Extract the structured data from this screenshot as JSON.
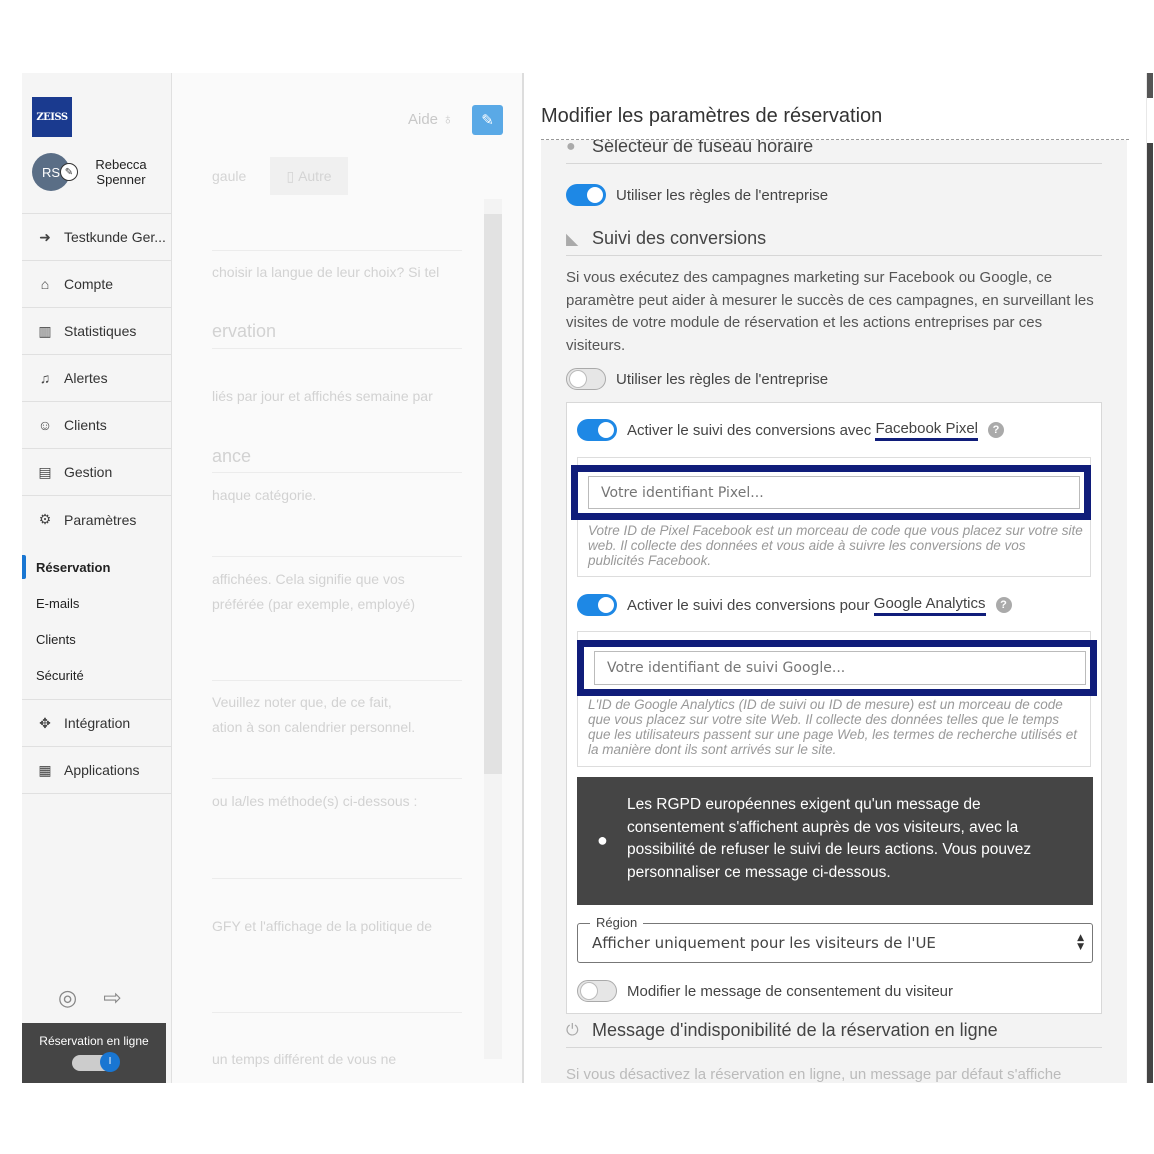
{
  "sidebar": {
    "logo_text": "ZEISS",
    "avatar_initials": "RS",
    "user_name": "Rebecca Spenner",
    "nav": [
      {
        "label": "Testkunde Ger...",
        "icon": "back-circle-icon"
      },
      {
        "label": "Compte",
        "icon": "briefcase-icon"
      },
      {
        "label": "Statistiques",
        "icon": "bar-chart-icon"
      },
      {
        "label": "Alertes",
        "icon": "bell-icon"
      },
      {
        "label": "Clients",
        "icon": "user-icon"
      },
      {
        "label": "Gestion",
        "icon": "toolbox-icon"
      },
      {
        "label": "Paramètres",
        "icon": "gears-icon"
      }
    ],
    "sub_nav": [
      {
        "label": "Réservation",
        "active": true
      },
      {
        "label": "E-mails"
      },
      {
        "label": "Clients"
      },
      {
        "label": "Sécurité"
      }
    ],
    "nav_bottom": [
      {
        "label": "Intégration",
        "icon": "puzzle-icon"
      },
      {
        "label": "Applications",
        "icon": "grid-icon"
      }
    ],
    "online_booking_label": "Réservation en ligne",
    "online_toggle_text": "I"
  },
  "background_page": {
    "help_label": "Aide",
    "tabs": [
      "gaule",
      "Autre"
    ],
    "lines": [
      "choisir la langue de leur choix? Si tel",
      "ervation",
      "liés par jour et affichés semaine par",
      "ance",
      "haque catégorie.",
      "affichées. Cela signifie que vos",
      "préférée (par exemple, employé)",
      "Veuillez noter que, de ce fait,",
      "ation à son calendrier personnel.",
      "ou la/les méthode(s) ci-dessous :",
      "GFY et l'affichage de la politique de",
      "un temps différent de vous ne"
    ]
  },
  "panel": {
    "title": "Modifier les paramètres de réservation",
    "timezone_heading": "Sélecteur de fuseau horaire",
    "timezone_toggle_label": "Utiliser les règles de l'entreprise",
    "conversions_heading": "Suivi des conversions",
    "conversions_description": "Si vous exécutez des campagnes marketing sur Facebook ou Google, ce paramètre peut aider à mesurer le succès de ces campagnes, en surveillant les visites de votre module de réservation et les actions entreprises par ces visiteurs.",
    "conversions_toggle_label": "Utiliser les règles de l'entreprise",
    "facebook_toggle_prefix": "Activer le suivi des conversions avec ",
    "facebook_toggle_name": "Facebook Pixel",
    "facebook_placeholder": "Votre identifiant Pixel...",
    "facebook_hint": "Votre ID de Pixel Facebook est un morceau de code que vous placez sur votre site web. Il collecte des données et vous aide à suivre les conversions de vos publicités Facebook.",
    "google_toggle_prefix": "Activer le suivi des conversions pour ",
    "google_toggle_name": "Google Analytics",
    "google_placeholder": "Votre identifiant de suivi Google...",
    "google_hint": "L'ID de Google Analytics (ID de suivi ou ID de mesure) est un morceau de code que vous placez sur votre site Web. Il collecte des données telles que le temps que les utilisateurs passent sur une page Web, les termes de recherche utilisés et la manière dont ils sont arrivés sur le site.",
    "gdpr_notice": "Les RGPD européennes exigent qu'un message de consentement s'affichent auprès de vos visiteurs, avec la possibilité de refuser le suivi de leurs actions. Vous pouvez personnaliser ce message ci-dessous.",
    "region_label": "Région",
    "region_value": "Afficher uniquement pour les visiteurs de l'UE",
    "consent_toggle_label": "Modifier le message de consentement du visiteur",
    "unavailability_heading": "Message d'indisponibilité de la réservation en ligne",
    "unavailability_text": "Si vous désactivez la réservation en ligne, un message par défaut s'affiche"
  },
  "colors": {
    "accent": "#1e88e5",
    "highlight": "#101d7a",
    "dark_notice": "#454545"
  }
}
